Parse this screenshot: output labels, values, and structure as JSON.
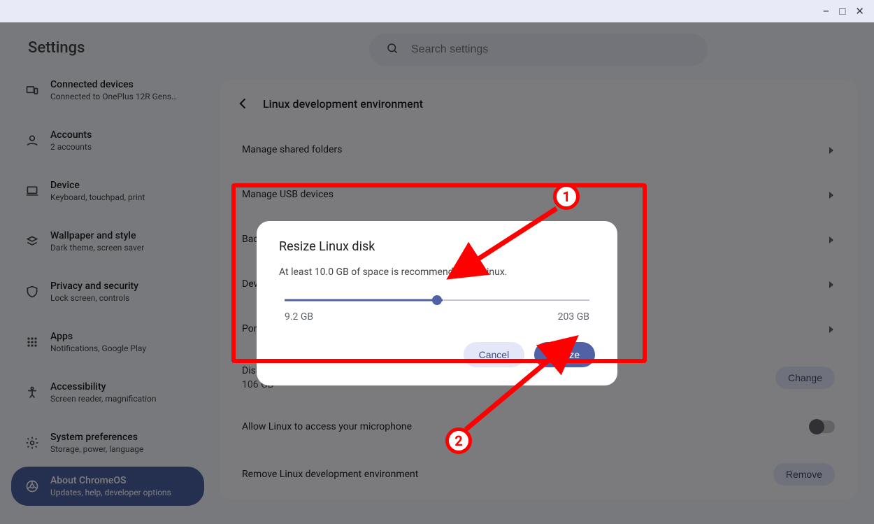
{
  "window_controls": {
    "minimize": "–",
    "maximize": "□",
    "close": "✕"
  },
  "sidebar": {
    "title": "Settings",
    "items": [
      {
        "label": "Connected devices",
        "sub": "Connected to OnePlus 12R Gens…",
        "icon": "devices"
      },
      {
        "label": "Accounts",
        "sub": "2 accounts",
        "icon": "account"
      },
      {
        "label": "Device",
        "sub": "Keyboard, touchpad, print",
        "icon": "laptop"
      },
      {
        "label": "Wallpaper and style",
        "sub": "Dark theme, screen saver",
        "icon": "palette"
      },
      {
        "label": "Privacy and security",
        "sub": "Lock screen, controls",
        "icon": "shield"
      },
      {
        "label": "Apps",
        "sub": "Notifications, Google Play",
        "icon": "apps"
      },
      {
        "label": "Accessibility",
        "sub": "Screen reader, magnification",
        "icon": "accessibility"
      },
      {
        "label": "System preferences",
        "sub": "Storage, power, language",
        "icon": "gear"
      },
      {
        "label": "About ChromeOS",
        "sub": "Updates, help, developer options",
        "icon": "chrome",
        "selected": true
      }
    ]
  },
  "search": {
    "placeholder": "Search settings"
  },
  "page": {
    "title": "Linux development environment",
    "rows": [
      {
        "label": "Manage shared folders",
        "chevron": true
      },
      {
        "label": "Manage USB devices",
        "chevron": true
      },
      {
        "label": "Back",
        "chevron": true
      },
      {
        "label": "Dev",
        "chevron": true
      },
      {
        "label": "Port",
        "chevron": true
      }
    ],
    "disk_size": {
      "label": "Disk size",
      "value": "106 GB",
      "button": "Change"
    },
    "mic": {
      "label": "Allow Linux to access your microphone"
    },
    "remove": {
      "label": "Remove Linux development environment",
      "button": "Remove"
    }
  },
  "dialog": {
    "title": "Resize Linux disk",
    "desc": "At least 10.0 GB of space is recommended for Linux.",
    "min_label": "9.2 GB",
    "max_label": "203 GB",
    "slider_percent": 50,
    "cancel": "Cancel",
    "confirm": "Resize"
  },
  "annotations": {
    "badge1": "1",
    "badge2": "2"
  }
}
